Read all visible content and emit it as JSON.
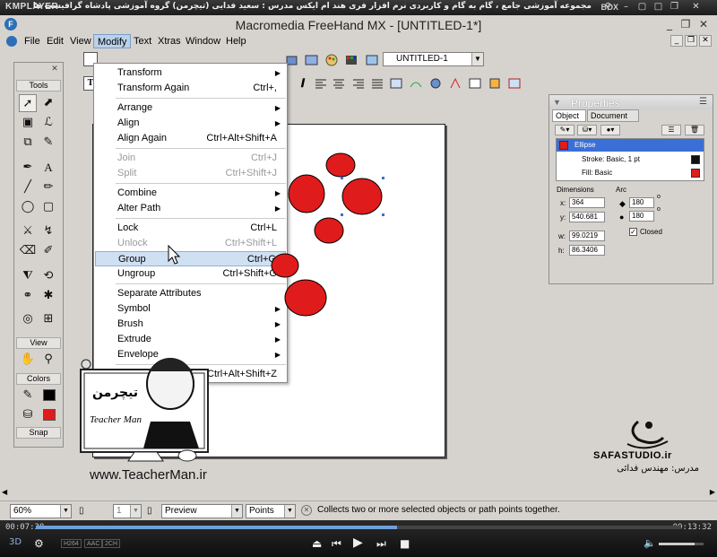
{
  "player": {
    "logo": "KMPLAYER",
    "title": "مجموعه آموزشی جامع ، گام به گام و کاربردی نرم افزار فری هند ام ایکس   مدرس : سعید فدایی (تیچرمن) گروه آموزشی پادشاه گرافیست ها",
    "box_label": "BOX",
    "time_elapsed": "00:07:38",
    "time_total": "00:13:32",
    "progress": 0.56,
    "chips": [
      "H264",
      "AAC",
      "2CH"
    ],
    "volume": 0.8
  },
  "app": {
    "title": "Macromedia FreeHand MX - [UNTITLED-1*]",
    "doc_select": "UNTITLED-1"
  },
  "menubar": [
    "File",
    "Edit",
    "View",
    "Modify",
    "Text",
    "Xtras",
    "Window",
    "Help"
  ],
  "modify_menu": [
    {
      "label": "Transform",
      "shortcut": "",
      "submenu": true,
      "disabled": false
    },
    {
      "label": "Transform Again",
      "shortcut": "Ctrl+,",
      "submenu": false,
      "disabled": false
    },
    {
      "sep": true
    },
    {
      "label": "Arrange",
      "shortcut": "",
      "submenu": true,
      "disabled": false
    },
    {
      "label": "Align",
      "shortcut": "",
      "submenu": true,
      "disabled": false
    },
    {
      "label": "Align Again",
      "shortcut": "Ctrl+Alt+Shift+A",
      "submenu": false,
      "disabled": false
    },
    {
      "sep": true
    },
    {
      "label": "Join",
      "shortcut": "Ctrl+J",
      "submenu": false,
      "disabled": true
    },
    {
      "label": "Split",
      "shortcut": "Ctrl+Shift+J",
      "submenu": false,
      "disabled": true
    },
    {
      "sep": true
    },
    {
      "label": "Combine",
      "shortcut": "",
      "submenu": true,
      "disabled": false
    },
    {
      "label": "Alter Path",
      "shortcut": "",
      "submenu": true,
      "disabled": false
    },
    {
      "sep": true
    },
    {
      "label": "Lock",
      "shortcut": "Ctrl+L",
      "submenu": false,
      "disabled": false
    },
    {
      "label": "Unlock",
      "shortcut": "Ctrl+Shift+L",
      "submenu": false,
      "disabled": true
    },
    {
      "label": "Group",
      "shortcut": "Ctrl+G",
      "submenu": false,
      "disabled": false,
      "highlight": true
    },
    {
      "label": "Ungroup",
      "shortcut": "Ctrl+Shift+G",
      "submenu": false,
      "disabled": false
    },
    {
      "sep": true
    },
    {
      "label": "Separate Attributes",
      "shortcut": "",
      "submenu": false,
      "disabled": false
    },
    {
      "label": "Symbol",
      "shortcut": "",
      "submenu": true,
      "disabled": false
    },
    {
      "label": "Brush",
      "shortcut": "",
      "submenu": true,
      "disabled": false
    },
    {
      "label": "Extrude",
      "shortcut": "",
      "submenu": true,
      "disabled": false
    },
    {
      "label": "Envelope",
      "shortcut": "",
      "submenu": true,
      "disabled": false
    },
    {
      "sep": true
    },
    {
      "label": "Convert",
      "shortcut": "Ctrl+Alt+Shift+Z",
      "submenu": false,
      "disabled": false
    }
  ],
  "tools": {
    "title": "Tools",
    "view_title": "View",
    "colors_title": "Colors",
    "snap_title": "Snap"
  },
  "properties": {
    "title": "Properties",
    "tabs": [
      "Object",
      "Document"
    ],
    "object_list": [
      {
        "label": "Ellipse",
        "swatch": "#e01b1b",
        "selected": true
      },
      {
        "label": "Stroke: Basic, 1 pt",
        "swatch": "#111111",
        "selected": false
      },
      {
        "label": "Fill: Basic",
        "swatch": "#e01b1b",
        "selected": false
      }
    ],
    "dimensions_label": "Dimensions",
    "arc_label": "Arc",
    "x_label": "x:",
    "x": "364",
    "y_label": "y:",
    "y": "540.681",
    "w_label": "w:",
    "w": "99.0219",
    "h_label": "h:",
    "h": "86.3406",
    "arc_start": "180",
    "arc_end": "180",
    "closed_label": "Closed"
  },
  "statusbar": {
    "zoom": "60%",
    "page": "1",
    "preview": "Preview",
    "units": "Points",
    "message": "Collects two or more selected objects or path points together."
  },
  "overlay": {
    "teacher_url": "www.TeacherMan.ir",
    "teacher_logo": "تیچرمن",
    "teacher_caption": "Teacher Man",
    "safa_name": "SAFASTUDIO.ir",
    "safa_teacher": "مدرس: مهندس فدائی"
  },
  "colors": {
    "accent_fill": "#e01b1b",
    "menu_highlight": "#cfe0f2",
    "selection_handle": "#3a6fd6"
  }
}
